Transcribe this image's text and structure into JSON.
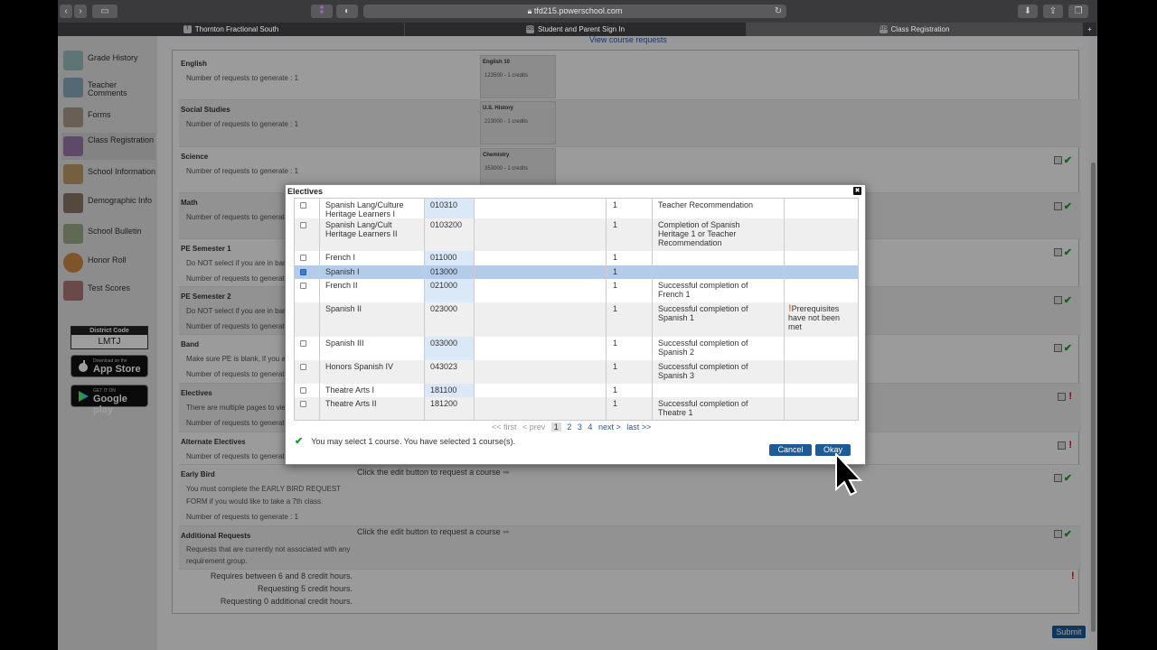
{
  "browser": {
    "url": "tfd215.powerschool.com",
    "tabs": [
      {
        "label": "Thornton Fractional South",
        "icon": "T"
      },
      {
        "label": "Student and Parent Sign In",
        "icon": "SIS"
      },
      {
        "label": "Class Registration",
        "icon": "SIS"
      }
    ]
  },
  "sidebar": {
    "items": [
      {
        "label": "Grade History"
      },
      {
        "label": "Teacher Comments"
      },
      {
        "label": "Forms"
      },
      {
        "label": "Class Registration"
      },
      {
        "label": "School Information"
      },
      {
        "label": "Demographic Info"
      },
      {
        "label": "School Bulletin"
      },
      {
        "label": "Honor Roll"
      },
      {
        "label": "Test Scores"
      }
    ],
    "district_code_label": "District Code",
    "district_code": "LMTJ",
    "appstore_small": "Download on the",
    "appstore_big": "App Store",
    "googleplay_small": "GET IT ON",
    "googleplay_big": "Google play"
  },
  "main": {
    "view_requests_link": "View course requests",
    "groups": [
      {
        "title": "English",
        "lines": [
          "Number of requests to generate : 1"
        ],
        "course_title": "English 10",
        "course_sub": "123500 - 1 credits"
      },
      {
        "title": "Social Studies",
        "lines": [
          "Number of requests to generate : 1"
        ],
        "course_title": "U.S. History",
        "course_sub": "223000 - 1 credits"
      },
      {
        "title": "Science",
        "lines": [
          "Number of requests to generate : 1"
        ],
        "course_title": "Chemistry",
        "course_sub": "353000 - 1 credits"
      },
      {
        "title": "Math",
        "lines": [
          "Number of requests to generate"
        ]
      },
      {
        "title": "PE Semester 1",
        "lines": [
          "Do NOT select if you are in band",
          "Number of requests to generate"
        ]
      },
      {
        "title": "PE Semester 2",
        "lines": [
          "Do NOT select if you are in band",
          "Number of requests to generate"
        ]
      },
      {
        "title": "Band",
        "lines": [
          "Make sure PE is blank, if you ar",
          "Number of requests to generate"
        ]
      },
      {
        "title": "Electives",
        "lines": [
          "There are multiple pages to view",
          "Number of requests to generate"
        ]
      },
      {
        "title": "Alternate Electives",
        "lines": [
          "Number of requests to generate"
        ]
      },
      {
        "title": "Early Bird",
        "lines": [
          "You must complete the EARLY BIRD REQUEST",
          "FORM if you would like to take a 7th class.",
          "Number of requests to generate : 1"
        ],
        "hint": "Click the edit button to request a course"
      },
      {
        "title": "Additional Requests",
        "lines": [
          "Requests that are currently not associated with any",
          "requirement group."
        ],
        "hint": "Click the edit button to request a course"
      }
    ],
    "credits": {
      "line1": "Requires between 6 and 8 credit hours.",
      "line2": "Requesting 5 credit hours.",
      "line3": "Requesting 0 additional credit hours."
    },
    "submit_label": "Submit"
  },
  "dialog": {
    "title": "Electives",
    "rows": [
      {
        "name": "Spanish Lang/Culture Heritage Learners I",
        "number": "010310",
        "credits": "1",
        "prereq": "Teacher Recommendation",
        "warning": "",
        "checkbox": true,
        "checked": false,
        "selected": false
      },
      {
        "name": "Spanish Lang/Cult Heritage Learners II",
        "number": "0103200",
        "credits": "1",
        "prereq": "Completion of Spanish Heritage 1 or Teacher Recommendation",
        "warning": "",
        "checkbox": true,
        "checked": false,
        "selected": false
      },
      {
        "name": "French I",
        "number": "011000",
        "credits": "1",
        "prereq": "",
        "warning": "",
        "checkbox": true,
        "checked": false,
        "selected": false
      },
      {
        "name": "Spanish I",
        "number": "013000",
        "credits": "1",
        "prereq": "",
        "warning": "",
        "checkbox": true,
        "checked": true,
        "selected": true
      },
      {
        "name": "French II",
        "number": "021000",
        "credits": "1",
        "prereq": "Successful completion of French 1",
        "warning": "",
        "checkbox": true,
        "checked": false,
        "selected": false
      },
      {
        "name": "Spanish II",
        "number": "023000",
        "credits": "1",
        "prereq": "Successful completion of Spanish 1",
        "warning": "Prerequisites have not been met",
        "checkbox": false,
        "checked": false,
        "selected": false
      },
      {
        "name": "Spanish III",
        "number": "033000",
        "credits": "1",
        "prereq": "Successful completion of Spanish 2",
        "warning": "",
        "checkbox": true,
        "checked": false,
        "selected": false
      },
      {
        "name": "Honors Spanish IV",
        "number": "043023",
        "credits": "1",
        "prereq": "Successful completion of Spanish 3",
        "warning": "",
        "checkbox": true,
        "checked": false,
        "selected": false
      },
      {
        "name": "Theatre Arts I",
        "number": "181100",
        "credits": "1",
        "prereq": "",
        "warning": "",
        "checkbox": true,
        "checked": false,
        "selected": false
      },
      {
        "name": "Theatre Arts II",
        "number": "181200",
        "credits": "1",
        "prereq": "Successful completion of Theatre 1",
        "warning": "",
        "checkbox": true,
        "checked": false,
        "selected": false
      }
    ],
    "pager": {
      "first": "<< first",
      "prev": "< prev",
      "pages": [
        "1",
        "2",
        "3",
        "4"
      ],
      "next": "next >",
      "last": "last >>"
    },
    "message": "You may select 1 course.  You have selected 1 course(s).",
    "cancel_label": "Cancel",
    "okay_label": "Okay"
  },
  "colors": {
    "accent": "#1e5a96",
    "link": "#2a55a6",
    "ok": "#1d9b2b",
    "error": "#d01010",
    "selected_row": "#b4cbe9"
  }
}
